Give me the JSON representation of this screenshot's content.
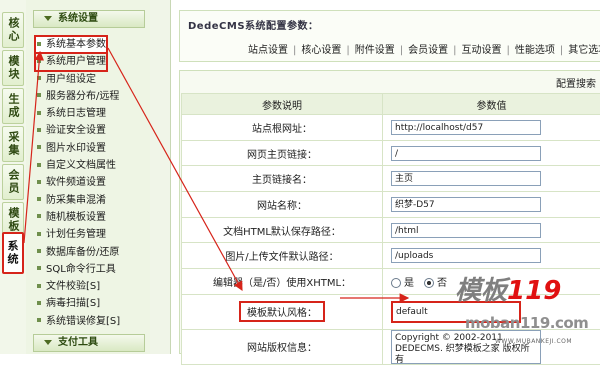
{
  "vertical_tabs": [
    {
      "label": "核心",
      "active": false
    },
    {
      "label": "模块",
      "active": false
    },
    {
      "label": "生成",
      "active": false
    },
    {
      "label": "采集",
      "active": false
    },
    {
      "label": "会员",
      "active": false
    },
    {
      "label": "模板",
      "active": false
    },
    {
      "label": "系统",
      "active": true
    }
  ],
  "menu": {
    "section_title": "系统设置",
    "items": [
      "系统基本参数",
      "系统用户管理",
      "用户组设定",
      "服务器分布/远程",
      "系统日志管理",
      "验证安全设置",
      "图片水印设置",
      "自定义文档属性",
      "软件频道设置",
      "防采集串混淆",
      "随机模板设置",
      "计划任务管理",
      "数据库备份/还原",
      "SQL命令行工具",
      "文件校验[S]",
      "病毒扫描[S]",
      "系统错误修复[S]"
    ],
    "footer_title": "支付工具"
  },
  "main": {
    "title": "DedeCMS系统配置参数：",
    "tabs": [
      "站点设置",
      "核心设置",
      "附件设置",
      "会员设置",
      "互动设置",
      "性能选项",
      "其它选项"
    ],
    "panel_title": "配置搜索",
    "col_label": "参数说明",
    "col_value": "参数值",
    "rows": [
      {
        "label": "站点根网址：",
        "value": "http://localhost/d57"
      },
      {
        "label": "网页主页链接：",
        "value": "/"
      },
      {
        "label": "主页链接名：",
        "value": "主页"
      },
      {
        "label": "网站名称：",
        "value": "织梦-D57"
      },
      {
        "label": "文档HTML默认保存路径：",
        "value": "/html"
      },
      {
        "label": "图片/上传文件默认路径：",
        "value": "/uploads"
      },
      {
        "label": "编辑器（是/否）使用XHTML：",
        "radio_yes": "是",
        "radio_no": "否"
      },
      {
        "label": "模板默认风格：",
        "value": "default"
      },
      {
        "label": "网站版权信息：",
        "value": "Copyright © 2002-2011 DEDECMS. 织梦模板之家 版权所有"
      }
    ]
  },
  "watermark": {
    "logo_text": "模板",
    "logo_num": "119",
    "url": "moban119.com",
    "url_small": "WWW.MUBANKEJI.COM"
  },
  "colors": {
    "highlight": "#d6241a",
    "menu_bg": "#eef5e4"
  }
}
